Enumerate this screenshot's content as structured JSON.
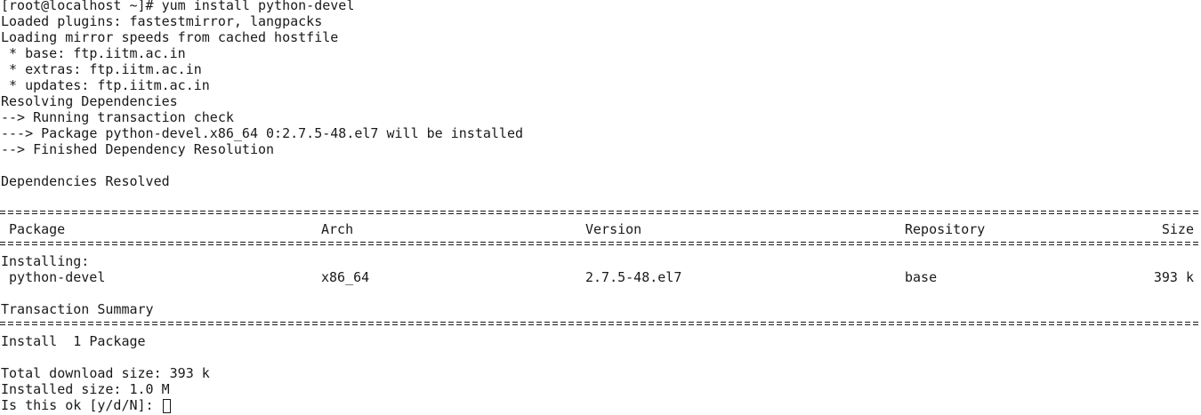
{
  "terminal": {
    "lines": [
      "[root@localhost ~]# yum install python-devel",
      "Loaded plugins: fastestmirror, langpacks",
      "Loading mirror speeds from cached hostfile",
      " * base: ftp.iitm.ac.in",
      " * extras: ftp.iitm.ac.in",
      " * updates: ftp.iitm.ac.in",
      "Resolving Dependencies",
      "--> Running transaction check",
      "---> Package python-devel.x86_64 0:2.7.5-48.el7 will be installed",
      "--> Finished Dependency Resolution",
      "Dependencies Resolved"
    ],
    "table": {
      "headers": {
        "package": "Package",
        "arch": "Arch",
        "version": "Version",
        "repository": "Repository",
        "size": "Size"
      },
      "section_label": "Installing:",
      "rows": [
        {
          "package": "python-devel",
          "arch": "x86_64",
          "version": "2.7.5-48.el7",
          "repository": "base",
          "size": "393 k"
        }
      ]
    },
    "summary": {
      "title": "Transaction Summary",
      "install_line": "Install  1 Package",
      "total_download": "Total download size: 393 k",
      "installed_size": "Installed size: 1.0 M",
      "prompt": "Is this ok [y/d/N]: "
    }
  }
}
